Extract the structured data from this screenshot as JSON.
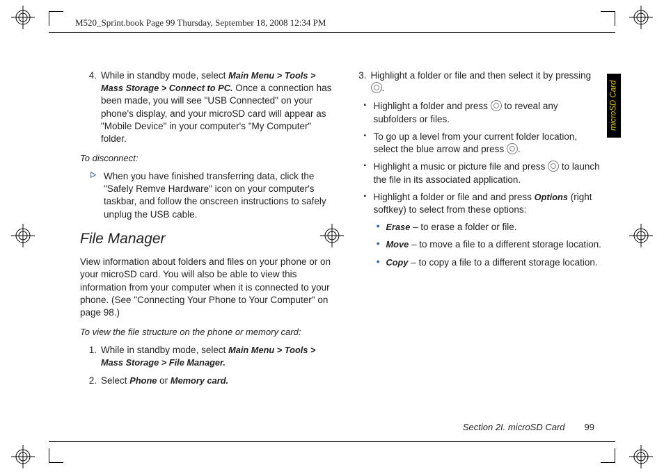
{
  "header": {
    "text": "M520_Sprint.book  Page 99  Thursday, September 18, 2008  12:34 PM"
  },
  "sidetab": {
    "label": "microSD Card"
  },
  "footer": {
    "section": "Section 2I. microSD Card",
    "page": "99"
  },
  "left": {
    "step4": {
      "num": "4.",
      "pre": "While in standby mode, select ",
      "menu": "Main Menu > Tools > Mass Storage > Connect to PC.",
      "post": " Once a connection has been made, you will see \"USB Connected\" on your phone's display, and your microSD card will appear as \"Mobile Device\" in your computer's \"My Computer\" folder."
    },
    "disconnect": {
      "label": "To disconnect:",
      "text": "When you have finished transferring data, click the \"Safely Remve Hardware\" icon on your computer's taskbar, and follow the onscreen instructions to safely unplug the USB cable."
    },
    "heading": "File Manager",
    "para": "View information about folders and files on your phone or on your microSD card. You will also be able to view this information from your computer when it is connected to your phone. (See \"Connecting Your Phone to Your Computer\" on page 98.)",
    "sub2": "To view the file structure on the phone or memory card:",
    "step1": {
      "num": "1.",
      "pre": "While in standby mode, select ",
      "menu": "Main Menu > Tools > Mass Storage > File Manager."
    },
    "step2": {
      "num": "2.",
      "pre": "Select ",
      "m1": "Phone",
      "mid": " or ",
      "m2": "Memory card."
    }
  },
  "right": {
    "step3": {
      "num": "3.",
      "pre": "Highlight a folder or file and then select it by pressing ",
      "post": "."
    },
    "b1": {
      "pre": "Highlight a folder and press ",
      "post": " to reveal any subfolders or files."
    },
    "b2": {
      "pre": "To go up a level from your current folder location, select the blue arrow and press ",
      "post": "."
    },
    "b3": {
      "pre": "Highlight a music or picture file and press ",
      "post": " to launch the file in its associated application."
    },
    "b4": {
      "pre": "Highlight a folder or file and and press ",
      "em": "Options",
      "post": " (right softkey) to select from these options:"
    },
    "s1": {
      "em": "Erase",
      "post": " – to erase a folder or file."
    },
    "s2": {
      "em": "Move",
      "post": " – to move a file to a different storage location."
    },
    "s3": {
      "em": "Copy",
      "post": " – to copy a file to a different storage location."
    }
  }
}
